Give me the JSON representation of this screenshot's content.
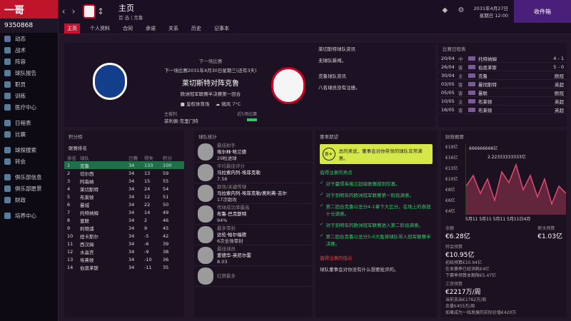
{
  "sidebar": {
    "logo": "一哥",
    "money": "9350868",
    "items": [
      {
        "label": "动态",
        "color": "#5a6f9a"
      },
      {
        "label": "战术",
        "color": "#5a7a9a"
      },
      {
        "label": "阵容",
        "color": "#5a7a9a"
      },
      {
        "label": "球队报告",
        "color": "#5a7a9a"
      },
      {
        "label": "职员",
        "color": "#5a7a9a"
      },
      {
        "label": "训练",
        "color": "#5a7a9a"
      },
      {
        "label": "医疗中心",
        "color": "#5a7a9a"
      }
    ],
    "items2": [
      {
        "label": "日程表",
        "color": "#5a7a9a"
      },
      {
        "label": "比赛",
        "color": "#5a7a9a"
      }
    ],
    "items3": [
      {
        "label": "球探搜索",
        "color": "#5a7a9a"
      },
      {
        "label": "转会",
        "color": "#5a7a9a"
      }
    ],
    "items4": [
      {
        "label": "俱乐部信息",
        "color": "#5a7a9a"
      },
      {
        "label": "俱乐部愿景",
        "color": "#5a7a9a"
      },
      {
        "label": "财政",
        "color": "#5a7a9a"
      }
    ],
    "items5": [
      {
        "label": "培养中心",
        "color": "#5a7a9a"
      }
    ]
  },
  "header": {
    "title": "主页",
    "subtitle": "首 选 | 克鲁",
    "date": "2031年4月27日",
    "time": "星期日 12:00",
    "inbox_label": "收件箱"
  },
  "tabs": [
    "主页",
    "个人资料",
    "合同",
    "承诺",
    "关系",
    "历史",
    "记事本"
  ],
  "next_match": {
    "heading": "下一场比赛",
    "date_line": "下一场比赛2031年4月30日星期三(还有3天)",
    "teams": "莱切斯特对阵克鲁",
    "competition": "欧洲冠军联赛半决赛第一回合",
    "stadium": "皇权体育场",
    "weather": "微风 7°C",
    "referee_label": "主裁判",
    "referee": "菲利佩·克里门特",
    "form_label": "近5场比赛"
  },
  "news": {
    "title1": "莱切斯特球队资讯",
    "line1": "无球队新闻。",
    "title2": "克鲁球队资讯",
    "line2": "八名球员没有注册。"
  },
  "results": {
    "title": "比赛日程表",
    "rows": [
      {
        "date": "20/04",
        "ha": "中",
        "opp": "托特纳姆",
        "score": "4 - 1"
      },
      {
        "date": "26/04",
        "ha": "客",
        "opp": "伯恩茅斯",
        "score": "5 - 0"
      },
      {
        "date": "30/04",
        "ha": "主",
        "opp": "克鲁",
        "score": "欧冠"
      },
      {
        "date": "03/05",
        "ha": "客",
        "opp": "曼彻斯特",
        "score": "英超"
      },
      {
        "date": "05/05",
        "ha": "客",
        "opp": "曼联",
        "score": "欧冠"
      },
      {
        "date": "10/05",
        "ha": "主",
        "opp": "布莱顿",
        "score": "英超"
      },
      {
        "date": "16/05",
        "ha": "客",
        "opp": "布莱顿",
        "score": "英超"
      }
    ]
  },
  "league": {
    "title": "积分榜",
    "subtitle": "联赛排名",
    "cols": [
      "排名",
      "球队",
      "已赛",
      "得失",
      "积分"
    ],
    "rows": [
      {
        "pos": "1",
        "team": "克鲁",
        "p": "34",
        "gd": "133",
        "pts": "100"
      },
      {
        "pos": "2",
        "team": "切尔西",
        "p": "34",
        "gd": "13",
        "pts": "59"
      },
      {
        "pos": "3",
        "team": "阿森纳",
        "p": "34",
        "gd": "15",
        "pts": "55"
      },
      {
        "pos": "4",
        "team": "莱切斯特",
        "p": "34",
        "gd": "24",
        "pts": "54"
      },
      {
        "pos": "5",
        "team": "布莱顿",
        "p": "34",
        "gd": "12",
        "pts": "51"
      },
      {
        "pos": "6",
        "team": "曼城",
        "p": "34",
        "gd": "22",
        "pts": "50"
      },
      {
        "pos": "7",
        "team": "托特纳姆",
        "p": "34",
        "gd": "14",
        "pts": "49"
      },
      {
        "pos": "8",
        "team": "富联",
        "p": "34",
        "gd": "2",
        "pts": "46"
      },
      {
        "pos": "9",
        "team": "利物浦",
        "p": "34",
        "gd": "9",
        "pts": "45"
      },
      {
        "pos": "10",
        "team": "纽卡斯尔",
        "p": "34",
        "gd": "-5",
        "pts": "42"
      },
      {
        "pos": "11",
        "team": "西汉姆",
        "p": "34",
        "gd": "-6",
        "pts": "39"
      },
      {
        "pos": "12",
        "team": "水晶宫",
        "p": "34",
        "gd": "-9",
        "pts": "38"
      },
      {
        "pos": "13",
        "team": "埃弗顿",
        "p": "34",
        "gd": "-10",
        "pts": "36"
      },
      {
        "pos": "14",
        "team": "伯恩茅斯",
        "p": "34",
        "gd": "-11",
        "pts": "35"
      }
    ]
  },
  "stats": {
    "title": "球队统计",
    "players": [
      {
        "label": "最佳射手",
        "name": "埃尔林·哈兰德",
        "stat": "29粒进球"
      },
      {
        "label": "平均最佳评分",
        "name": "马拉索内列-埃菲克勒",
        "stat": "7.56"
      },
      {
        "label": "助攻/关键传球",
        "name": "马拉索内列-埃菲克勒/奥利弗-吉尔",
        "stat": "17次助攻"
      },
      {
        "label": "传球成功率最高",
        "name": "布鲁-巴克斯特",
        "stat": "94%"
      },
      {
        "label": "最多零封",
        "name": "达伦·帕尔福德",
        "stat": "6次全场零封"
      },
      {
        "label": "最佳球员",
        "name": "爱德华-英尼尔雷",
        "stat": "8.03"
      },
      {
        "label": "红牌最多",
        "name": "",
        "stat": ""
      }
    ]
  },
  "expectations": {
    "title": "董事期望",
    "grade": "B+",
    "message": "总的来说，董事会对你带领的球队非常满意。",
    "pos_title": "值得注意的亮点",
    "positives": [
      "对于赢得英格兰超级联赛感到欣喜。",
      "对于到明年的欧洲冠军联赛第一阶段满意。",
      "第二回合克鲁以总分4-1拿下大比分，在场上的表现十分满意。",
      "对于到明年的欧洲冠军联赛进入第二阶段满意。",
      "第二回合克鲁以总分5-0大胜将球队带入冠军联赛半决赛。"
    ],
    "neg_title": "值得注意的低谷",
    "negatives": "球队董事会对你没有什么想要批评的。"
  },
  "finance": {
    "title": "财政概要",
    "y_labels": [
      "€19亿",
      "€16亿",
      "€13亿",
      "€10亿",
      "€8亿",
      "€6亿",
      "€4亿"
    ],
    "legend": [
      "666666666亿",
      "2.22333333333亿",
      "0"
    ],
    "x_label": "5月11 5月11 5月11 5月11日4月",
    "balance_label": "余额",
    "balance": "€6.28亿",
    "transfer_label": "转会预算",
    "transfer": "€10.95亿",
    "wage_label": "薪水预算",
    "wage": "€1.03亿",
    "lines": [
      "初始预算€10.94亿",
      "在本赛季已经消耗€4亿",
      "下赛季预算本期限€5.47亿"
    ],
    "wage_week_label": "工资预算",
    "wage_week": "€2217万/周",
    "wage_lines": [
      "当前支出€1762万/周",
      "余量€455万/周",
      "如果成为一线发展的实际价值€420万"
    ]
  }
}
